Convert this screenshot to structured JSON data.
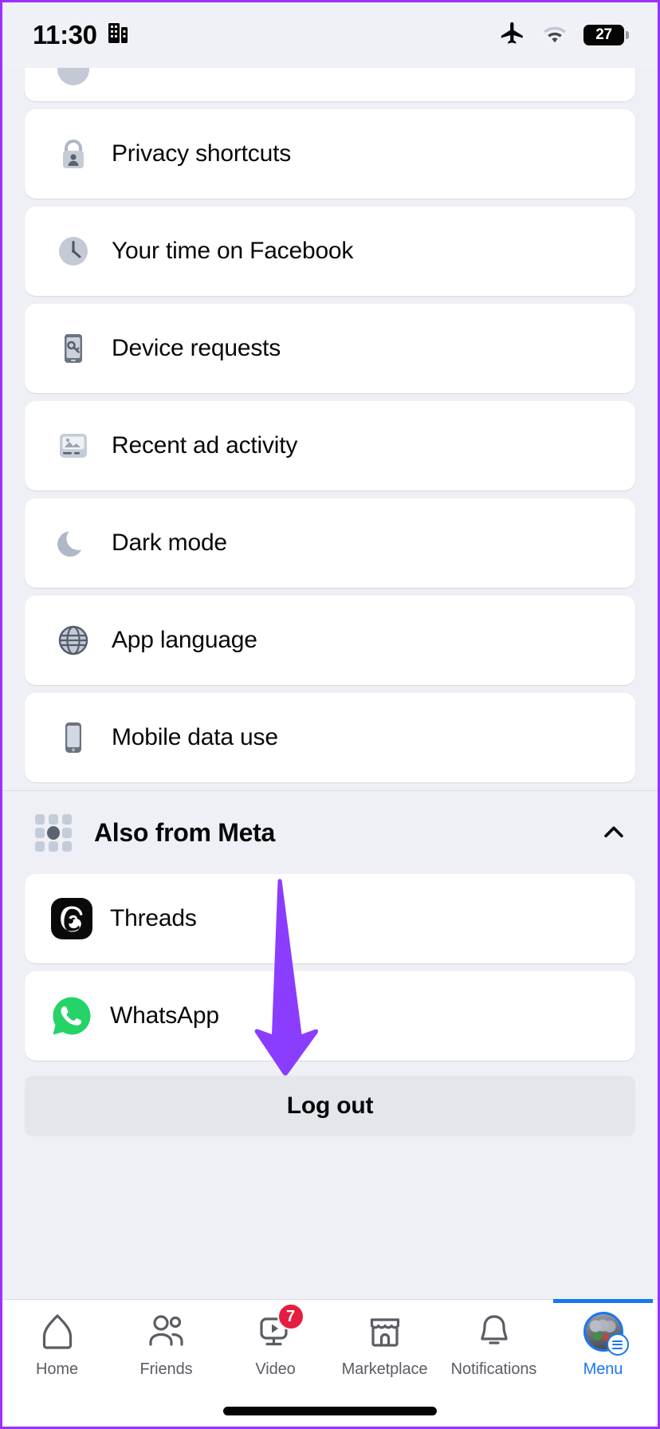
{
  "status_bar": {
    "time": "11:30",
    "building_icon": "building-icon",
    "airplane_icon": "airplane-mode-icon",
    "wifi_icon": "wifi-icon",
    "battery_percent": "27"
  },
  "menu": {
    "clipped_top_item": {
      "label": "",
      "icon": "settings-icon"
    },
    "items": [
      {
        "label": "Privacy shortcuts",
        "icon": "privacy-lock-icon"
      },
      {
        "label": "Your time on Facebook",
        "icon": "clock-icon"
      },
      {
        "label": "Device requests",
        "icon": "device-requests-icon"
      },
      {
        "label": "Recent ad activity",
        "icon": "recent-ad-activity-icon"
      },
      {
        "label": "Dark mode",
        "icon": "moon-icon"
      },
      {
        "label": "App language",
        "icon": "globe-icon"
      },
      {
        "label": "Mobile data use",
        "icon": "mobile-phone-icon"
      }
    ]
  },
  "also_from_meta": {
    "title": "Also from Meta",
    "header_icon": "meta-apps-grid-icon",
    "expanded": true,
    "chevron_icon": "chevron-up-icon",
    "apps": [
      {
        "label": "Threads",
        "icon": "threads-icon"
      },
      {
        "label": "WhatsApp",
        "icon": "whatsapp-icon"
      }
    ]
  },
  "logout": {
    "label": "Log out"
  },
  "annotation": {
    "type": "arrow",
    "direction": "down",
    "color": "#8b3dff",
    "points_to": "Log out"
  },
  "tab_bar": {
    "active_tab": "Menu",
    "active_color": "#1877f2",
    "tabs": [
      {
        "label": "Home",
        "icon": "home-icon",
        "badge": ""
      },
      {
        "label": "Friends",
        "icon": "friends-icon",
        "badge": ""
      },
      {
        "label": "Video",
        "icon": "video-icon",
        "badge": "7"
      },
      {
        "label": "Marketplace",
        "icon": "marketplace-icon",
        "badge": ""
      },
      {
        "label": "Notifications",
        "icon": "bell-icon",
        "badge": ""
      },
      {
        "label": "Menu",
        "icon": "profile-avatar-menu-icon",
        "badge": ""
      }
    ]
  }
}
